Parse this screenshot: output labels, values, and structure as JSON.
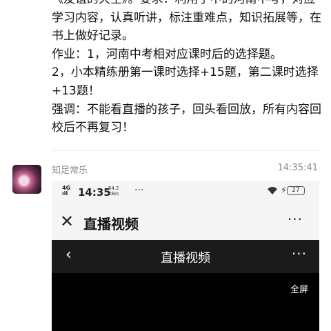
{
  "message": {
    "lines": [
      "《友谊的天空》。要求：利用手中的河南中考，对应学习内容，认真听讲，标注重难点，知识拓展等，在书上做好记录。",
      "作业：1，河南中考相对应课时后的选择题。",
      "2，小本精练册第一课时选择+15题，第二课时选择+13题！",
      "强调：不能看直播的孩子，回头看回放，所有内容回校后不再复习！"
    ]
  },
  "post": {
    "sender": "知足常乐",
    "time": "14:35:41"
  },
  "screenshot": {
    "status_bar": {
      "signal": "4G",
      "signal2": "ıll",
      "time": "14:35",
      "speed_top": "54.2",
      "speed_bottom": "KB/s",
      "dots": "···",
      "charge": "⚡",
      "battery": "27"
    },
    "app_bar": {
      "close_icon": "✕",
      "title": "直播视频",
      "more": "···"
    },
    "video_nav": {
      "back_icon": "‹",
      "title": "直播视频",
      "more": "···"
    },
    "fullscreen_label": "全屏"
  }
}
